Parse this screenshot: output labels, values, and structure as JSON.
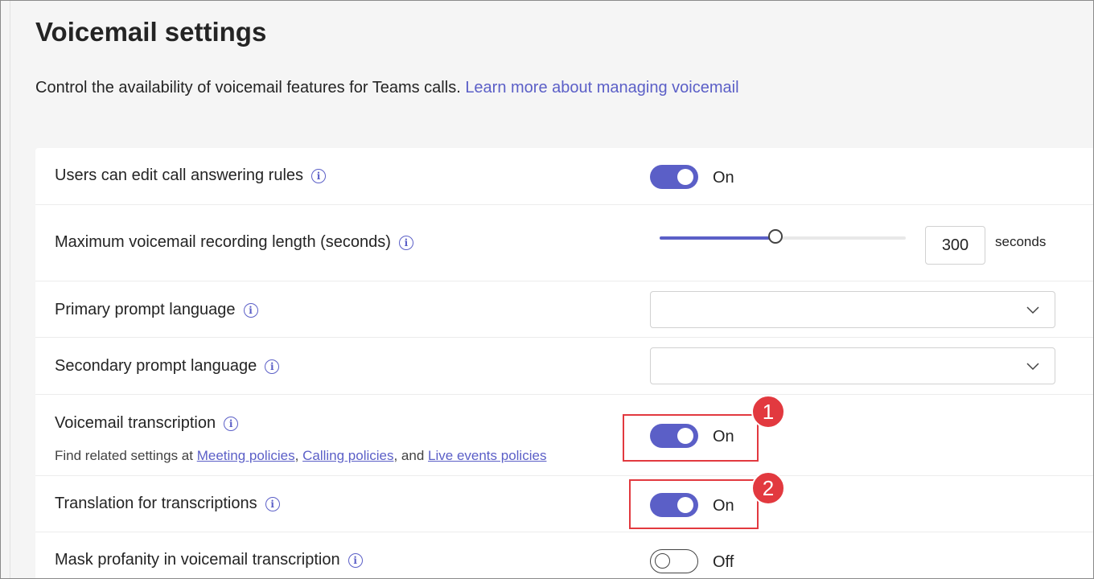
{
  "page": {
    "title": "Voicemail settings",
    "description": "Control the availability of voicemail features for Teams calls.",
    "learn_more_link": "Learn more about managing voicemail"
  },
  "settings": {
    "edit_rules": {
      "label": "Users can edit call answering rules",
      "state": "On",
      "enabled": true
    },
    "max_length": {
      "label": "Maximum voicemail recording length (seconds)",
      "value": "300",
      "unit": "seconds",
      "slider_fraction": 0.47
    },
    "primary_language": {
      "label": "Primary prompt language",
      "value": ""
    },
    "secondary_language": {
      "label": "Secondary prompt language",
      "value": ""
    },
    "transcription": {
      "label": "Voicemail transcription",
      "state": "On",
      "enabled": true,
      "related_prefix": "Find related settings at",
      "link_meeting": "Meeting policies",
      "sep1": ",",
      "link_calling": "Calling policies",
      "sep2": ", and",
      "link_live": "Live events policies"
    },
    "translation": {
      "label": "Translation for transcriptions",
      "state": "On",
      "enabled": true
    },
    "mask_profanity": {
      "label": "Mask profanity in voicemail transcription",
      "state": "Off",
      "enabled": false
    }
  },
  "annotations": {
    "badge_1": "1",
    "badge_2": "2",
    "color": "#e2393f"
  },
  "colors": {
    "accent": "#5b5fc7",
    "background": "#f5f5f5",
    "card": "#ffffff"
  },
  "icons": {
    "info": "info-icon",
    "dropdown": "chevron-down-icon"
  }
}
